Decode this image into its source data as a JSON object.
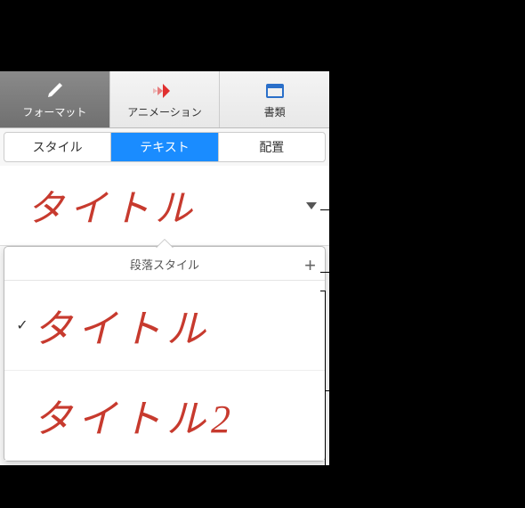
{
  "toolbar": {
    "format": "フォーマット",
    "animation": "アニメーション",
    "document": "書類"
  },
  "tabs": {
    "style": "スタイル",
    "text": "テキスト",
    "arrange": "配置"
  },
  "currentStyle": "タイトル",
  "popover": {
    "title": "段落スタイル",
    "items": [
      {
        "label": "タイトル",
        "checked": true
      },
      {
        "label": "タイトル2",
        "checked": false
      }
    ]
  },
  "colors": {
    "accentRed": "#c73a2e",
    "tabActive": "#1a8cff"
  }
}
